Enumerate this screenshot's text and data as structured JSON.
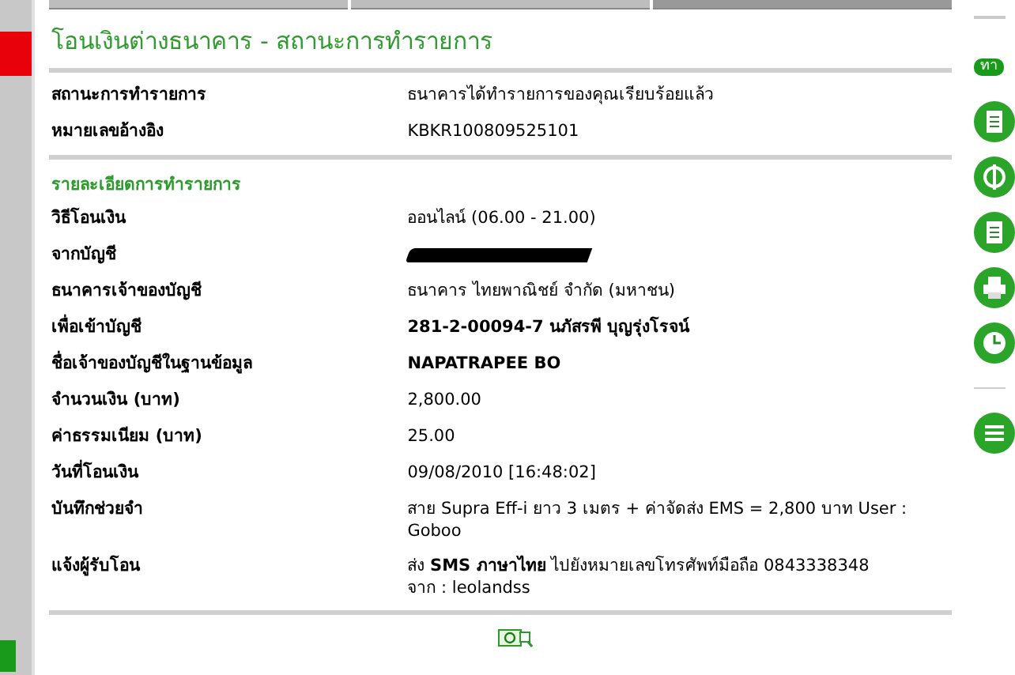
{
  "title": "โอนเงินต่างธนาคาร - สถานะการทำรายการ",
  "summary": [
    {
      "label": "สถานะการทำรายการ",
      "value": "ธนาคารได้ทำรายการของคุณเรียบร้อยแล้ว",
      "kind": "text"
    },
    {
      "label": "หมายเลขอ้างอิง",
      "value": "KBKR100809525101",
      "kind": "text"
    }
  ],
  "details_heading": "รายละเอียดการทำรายการ",
  "details": [
    {
      "label": "วิธีโอนเงิน",
      "value": "ออนไลน์ (06.00 - 21.00)",
      "kind": "text"
    },
    {
      "label": "จากบัญชี",
      "kind": "redacted"
    },
    {
      "label": "ธนาคารเจ้าของบัญชี",
      "value": "ธนาคาร ไทยพาณิชย์ จำกัด (มหาชน)",
      "kind": "text"
    },
    {
      "label": "เพื่อเข้าบัญชี",
      "value": "281-2-00094-7 นภัสรพี บุญรุ่งโรจน์",
      "kind": "bold"
    },
    {
      "label": "ชื่อเจ้าของบัญชีในฐานข้อมูล",
      "value": "NAPATRAPEE BO",
      "kind": "bold"
    },
    {
      "label": "จำนวนเงิน (บาท)",
      "value": "2,800.00",
      "kind": "text"
    },
    {
      "label": "ค่าธรรมเนียม (บาท)",
      "value": "25.00",
      "kind": "text"
    },
    {
      "label": "วันที่โอนเงิน",
      "value": "09/08/2010 [16:48:02]",
      "kind": "text"
    },
    {
      "label": "บันทึกช่วยจำ",
      "value": "สาย Supra Eff-i ยาว 3 เมตร + ค่าจัดส่ง EMS = 2,800 บาท User : Goboo",
      "kind": "text"
    },
    {
      "label": "แจ้งผู้รับโอน",
      "value": "ส่ง **SMS ภาษาไทย** ไปยังหมายเลขโทรศัพท์มือถือ 0843338348\nจาก : leolandss",
      "kind": "rich"
    }
  ],
  "sidebar": {
    "badge": "ทา"
  },
  "top_tabs": [
    {
      "selected": false
    },
    {
      "selected": false
    },
    {
      "selected": true
    }
  ]
}
